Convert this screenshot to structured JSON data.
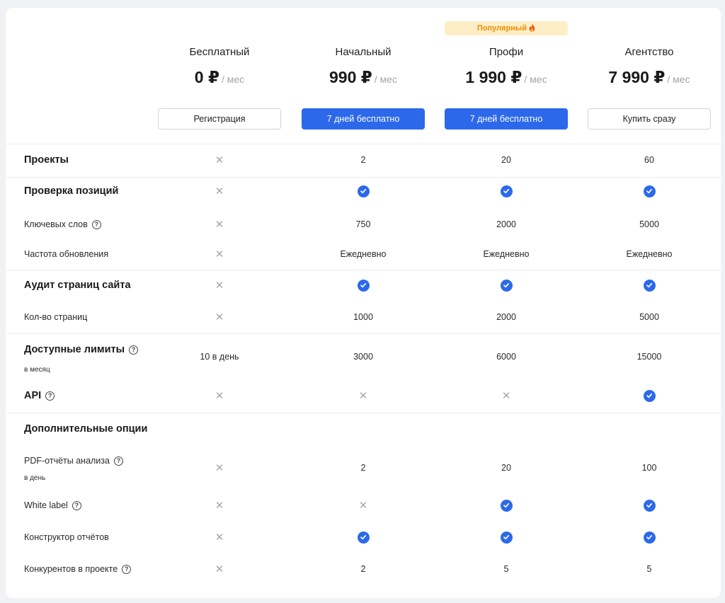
{
  "plans": [
    {
      "name": "Бесплатный",
      "amount": "0 ₽",
      "per": "/ мес",
      "button": "Регистрация",
      "style": "outline"
    },
    {
      "name": "Начальный",
      "amount": "990 ₽",
      "per": "/ мес",
      "button": "7 дней бесплатно",
      "style": "primary"
    },
    {
      "name": "Профи",
      "amount": "1 990 ₽",
      "per": "/ мес",
      "button": "7 дней бесплатно",
      "style": "primary",
      "badge": "Популярный"
    },
    {
      "name": "Агентство",
      "amount": "7 990 ₽",
      "per": "/ мес",
      "button": "Купить сразу",
      "style": "outline"
    }
  ],
  "icons": {
    "cross": "cross-icon",
    "check": "check-circle-icon",
    "help": "help-circle-icon",
    "flame": "flame-icon"
  },
  "colors": {
    "accent": "#2c69ea",
    "badge_bg": "#fdeec6",
    "badge_text": "#f08c00",
    "muted": "#a6a7ab"
  },
  "features": [
    {
      "label": "Проекты",
      "bold": true,
      "values": [
        "x",
        "2",
        "20",
        "60"
      ]
    },
    {
      "label": "Проверка позиций",
      "bold": true,
      "values": [
        "x",
        "check",
        "check",
        "check"
      ]
    },
    {
      "label": "Ключевых слов",
      "help": true,
      "values": [
        "x",
        "750",
        "2000",
        "5000"
      ]
    },
    {
      "label": "Частота обновления",
      "values": [
        "x",
        "Ежедневно",
        "Ежедневно",
        "Ежедневно"
      ]
    },
    {
      "label": "Аудит страниц сайта",
      "bold": true,
      "values": [
        "x",
        "check",
        "check",
        "check"
      ]
    },
    {
      "label": "Кол-во страниц",
      "values": [
        "x",
        "1000",
        "2000",
        "5000"
      ]
    },
    {
      "label": "Доступные лимиты",
      "bold": true,
      "help": true,
      "sub": "в месяц",
      "values": [
        "10 в день",
        "3000",
        "6000",
        "15000"
      ]
    },
    {
      "label": "API",
      "bold": true,
      "help": true,
      "values": [
        "x",
        "x",
        "x",
        "check"
      ]
    },
    {
      "label": "Дополнительные опции",
      "bold": true,
      "values": []
    },
    {
      "label": "PDF-отчёты анализа",
      "help": true,
      "sub": "в день",
      "values": [
        "x",
        "2",
        "20",
        "100"
      ]
    },
    {
      "label": "White label",
      "help": true,
      "values": [
        "x",
        "x",
        "check",
        "check"
      ]
    },
    {
      "label": "Конструктор отчётов",
      "values": [
        "x",
        "check",
        "check",
        "check"
      ]
    },
    {
      "label": "Конкурентов в проекте",
      "help": true,
      "values": [
        "x",
        "2",
        "5",
        "5"
      ]
    }
  ]
}
